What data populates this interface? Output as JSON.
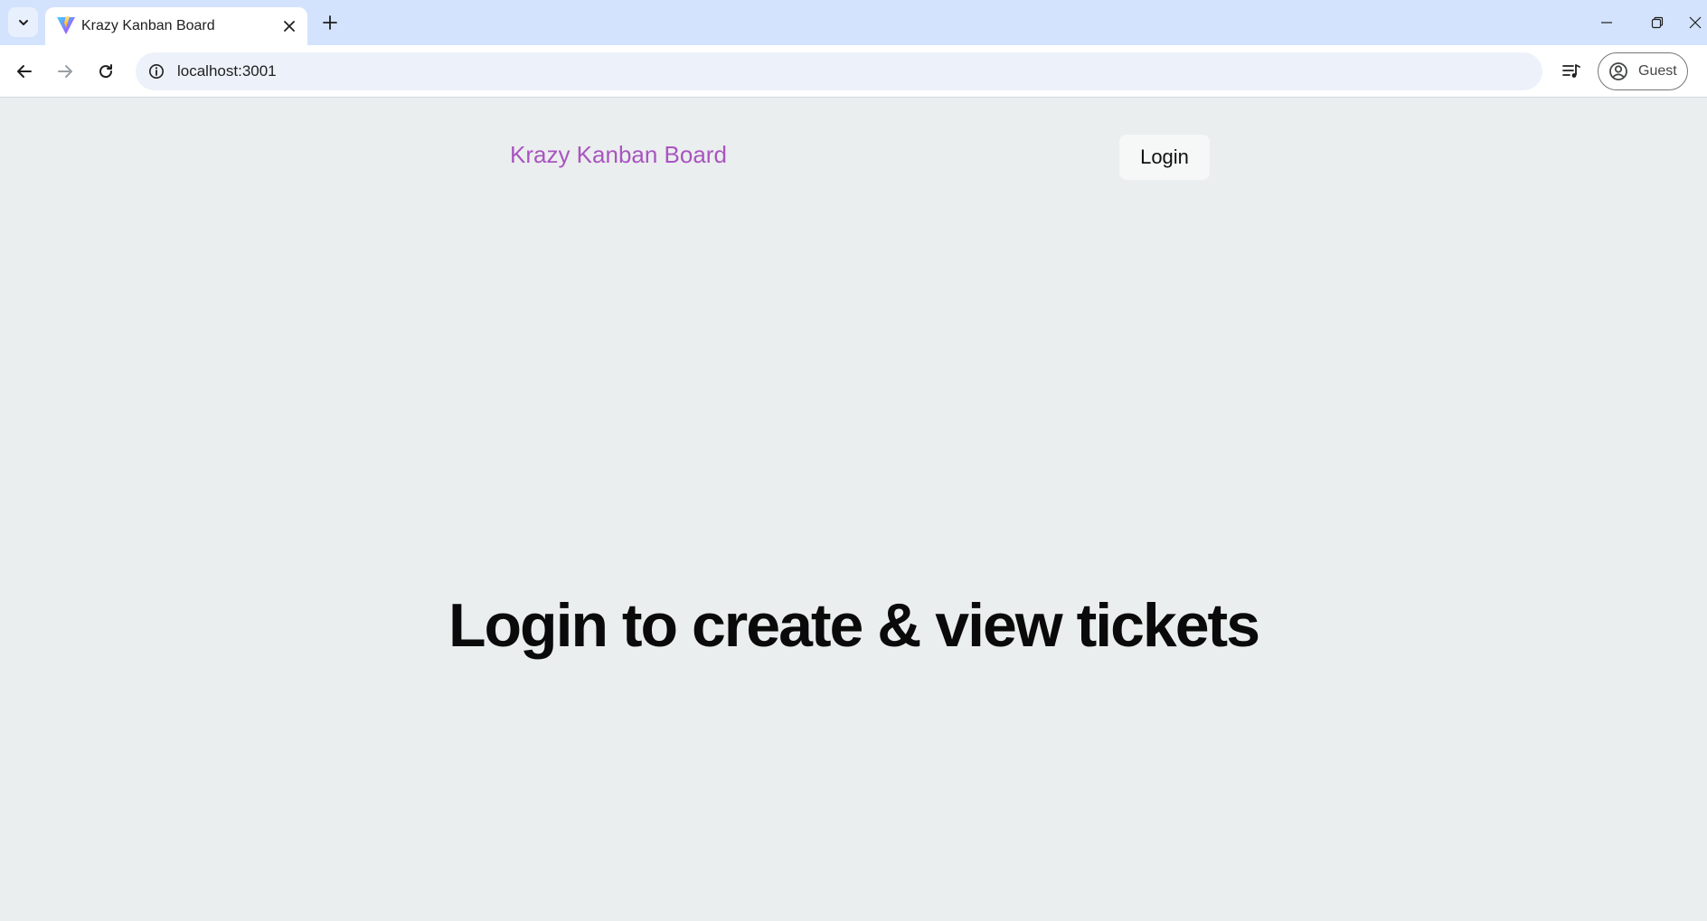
{
  "browser": {
    "tab": {
      "title": "Krazy Kanban Board",
      "favicon": "vite-logo-icon"
    },
    "address_bar": {
      "url": "localhost:3001"
    },
    "profile": {
      "label": "Guest"
    },
    "icons": {
      "tab_search": "chevron-down-icon",
      "tab_close": "close-icon",
      "new_tab": "plus-icon",
      "minimize": "minimize-icon",
      "restore": "restore-icon",
      "close_window": "close-icon",
      "back": "arrow-left-icon",
      "forward": "arrow-right-icon",
      "reload": "reload-icon",
      "site_info": "info-icon",
      "media": "media-control-icon",
      "profile": "account-circle-icon"
    }
  },
  "app": {
    "title": "Krazy Kanban Board",
    "login_label": "Login",
    "heading": "Login to create & view tickets"
  },
  "colors": {
    "page_background": "#ebeeee",
    "brand_title": "#a855c0",
    "tabbar": "#d3e3fd"
  }
}
